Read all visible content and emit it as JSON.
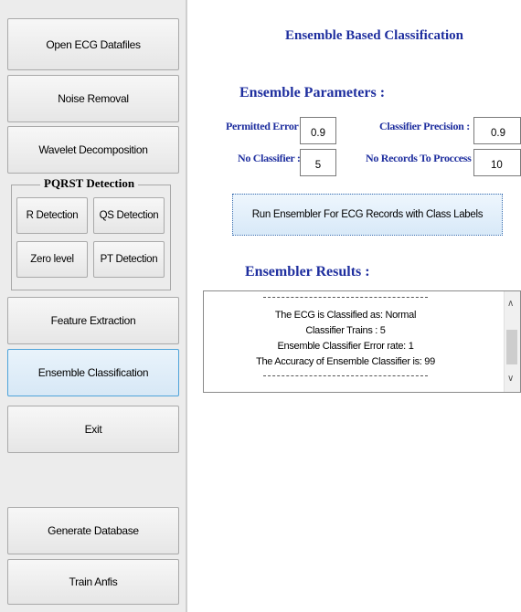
{
  "sidebar": {
    "open_ecg": "Open ECG Datafiles",
    "noise_removal": "Noise Removal",
    "wavelet": "Wavelet Decomposition",
    "pqrst_title": "PQRST Detection",
    "r_detection": "R Detection",
    "qs_detection": "QS Detection",
    "zero_level": "Zero level",
    "pt_detection": "PT Detection",
    "feature_extraction": "Feature Extraction",
    "ensemble_classification": "Ensemble Classification",
    "exit": "Exit",
    "generate_database": "Generate Database",
    "train_anfis": "Train Anfis"
  },
  "main": {
    "title": "Ensemble Based Classification",
    "params_heading": "Ensemble Parameters :",
    "permitted_error_label": "Permitted Error :",
    "permitted_error_value": "0.9",
    "classifier_precision_label": "Classifier Precision :",
    "classifier_precision_value": "0.9",
    "no_classifier_label": "No Classifier :",
    "no_classifier_value": "5",
    "no_records_label": "No Records To Proccess :",
    "no_records_value": "10",
    "run_button": "Run Ensembler For ECG Records with Class Labels",
    "results_heading": "Ensembler Results :",
    "results": {
      "classified": "The ECG is Classified as:  Normal",
      "trains": "Classifier Trains :  5",
      "error_rate": "Ensemble Classifier Error rate:  1",
      "accuracy": "The Accuracy of Ensemble Classifier is:  99"
    }
  },
  "icons": {
    "scroll_up": "scroll-up-arrow-icon",
    "scroll_down": "scroll-down-arrow-icon"
  },
  "colors": {
    "heading_blue": "#1f2f9f",
    "active_border": "#4fa3d9"
  }
}
